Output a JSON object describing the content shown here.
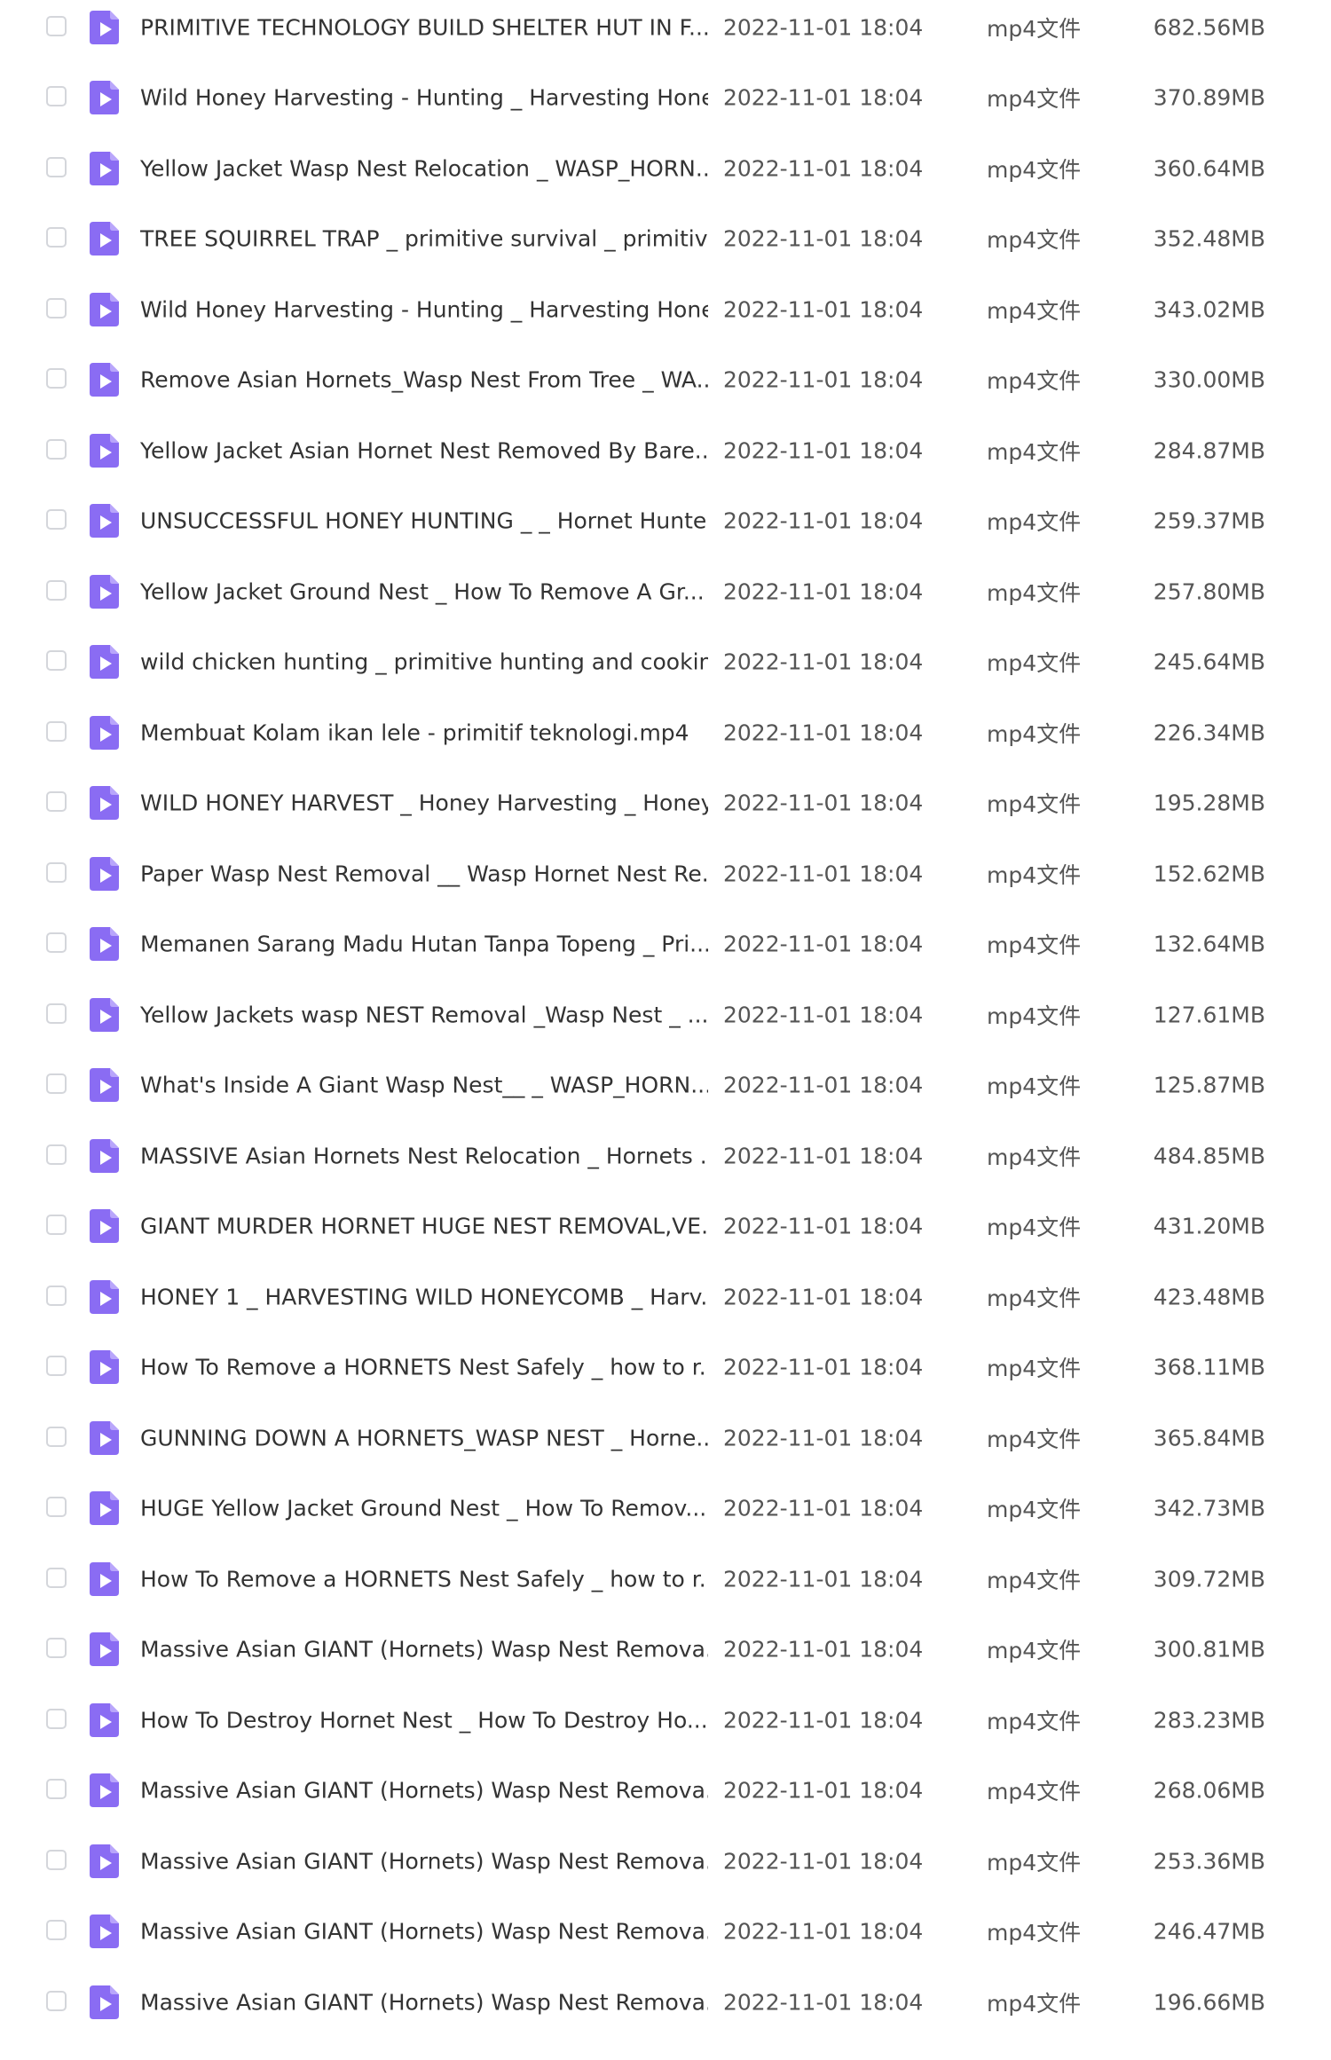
{
  "accent_color": "#8a6cf3",
  "file_icon": "video-file-icon",
  "files": [
    {
      "name": "PRIMITIVE TECHNOLOGY BUILD SHELTER HUT IN F...",
      "date": "2022-11-01 18:04",
      "type": "mp4文件",
      "size": "682.56MB"
    },
    {
      "name": "Wild Honey Harvesting - Hunting _ Harvesting Hone...",
      "date": "2022-11-01 18:04",
      "type": "mp4文件",
      "size": "370.89MB"
    },
    {
      "name": "Yellow Jacket Wasp Nest Relocation _ WASP_HORN...",
      "date": "2022-11-01 18:04",
      "type": "mp4文件",
      "size": "360.64MB"
    },
    {
      "name": "TREE SQUIRREL TRAP _ primitive survival _ primitiv...",
      "date": "2022-11-01 18:04",
      "type": "mp4文件",
      "size": "352.48MB"
    },
    {
      "name": "Wild Honey Harvesting - Hunting _ Harvesting Hone...",
      "date": "2022-11-01 18:04",
      "type": "mp4文件",
      "size": "343.02MB"
    },
    {
      "name": "Remove Asian Hornets_Wasp Nest From Tree _ WA...",
      "date": "2022-11-01 18:04",
      "type": "mp4文件",
      "size": "330.00MB"
    },
    {
      "name": "Yellow Jacket Asian Hornet Nest Removed By Bare...",
      "date": "2022-11-01 18:04",
      "type": "mp4文件",
      "size": "284.87MB"
    },
    {
      "name": "UNSUCCESSFUL HONEY HUNTING _ _ Hornet Hunte...",
      "date": "2022-11-01 18:04",
      "type": "mp4文件",
      "size": "259.37MB"
    },
    {
      "name": "Yellow Jacket Ground Nest _ How To Remove A Gr...",
      "date": "2022-11-01 18:04",
      "type": "mp4文件",
      "size": "257.80MB"
    },
    {
      "name": "wild chicken hunting _ primitive hunting and cookin...",
      "date": "2022-11-01 18:04",
      "type": "mp4文件",
      "size": "245.64MB"
    },
    {
      "name": "Membuat Kolam ikan lele - primitif teknologi.mp4",
      "date": "2022-11-01 18:04",
      "type": "mp4文件",
      "size": "226.34MB"
    },
    {
      "name": "WILD HONEY HARVEST _ Honey Harvesting _ Honey...",
      "date": "2022-11-01 18:04",
      "type": "mp4文件",
      "size": "195.28MB"
    },
    {
      "name": "Paper Wasp Nest Removal __ Wasp Hornet Nest Re...",
      "date": "2022-11-01 18:04",
      "type": "mp4文件",
      "size": "152.62MB"
    },
    {
      "name": "Memanen Sarang Madu Hutan Tanpa Topeng _ Pri...",
      "date": "2022-11-01 18:04",
      "type": "mp4文件",
      "size": "132.64MB"
    },
    {
      "name": "Yellow Jackets wasp NEST Removal _Wasp Nest _ ...",
      "date": "2022-11-01 18:04",
      "type": "mp4文件",
      "size": "127.61MB"
    },
    {
      "name": "What's Inside A Giant Wasp Nest__ _ WASP_HORN...",
      "date": "2022-11-01 18:04",
      "type": "mp4文件",
      "size": "125.87MB"
    },
    {
      "name": "MASSIVE Asian Hornets Nest Relocation _ Hornets ...",
      "date": "2022-11-01 18:04",
      "type": "mp4文件",
      "size": "484.85MB"
    },
    {
      "name": "GIANT MURDER HORNET HUGE NEST REMOVAL,VE...",
      "date": "2022-11-01 18:04",
      "type": "mp4文件",
      "size": "431.20MB"
    },
    {
      "name": "HONEY 1 _ HARVESTING WILD HONEYCOMB _ Harv...",
      "date": "2022-11-01 18:04",
      "type": "mp4文件",
      "size": "423.48MB"
    },
    {
      "name": "How To Remove a HORNETS Nest Safely _ how to r...",
      "date": "2022-11-01 18:04",
      "type": "mp4文件",
      "size": "368.11MB"
    },
    {
      "name": "GUNNING DOWN A HORNETS_WASP NEST _ Horne...",
      "date": "2022-11-01 18:04",
      "type": "mp4文件",
      "size": "365.84MB"
    },
    {
      "name": "HUGE Yellow Jacket Ground Nest _ How To Remov...",
      "date": "2022-11-01 18:04",
      "type": "mp4文件",
      "size": "342.73MB"
    },
    {
      "name": "How To Remove a HORNETS Nest Safely _ how to r...",
      "date": "2022-11-01 18:04",
      "type": "mp4文件",
      "size": "309.72MB"
    },
    {
      "name": "Massive Asian GIANT (Hornets) Wasp Nest Remova...",
      "date": "2022-11-01 18:04",
      "type": "mp4文件",
      "size": "300.81MB"
    },
    {
      "name": "How To Destroy Hornet Nest _ How To Destroy Ho...",
      "date": "2022-11-01 18:04",
      "type": "mp4文件",
      "size": "283.23MB"
    },
    {
      "name": "Massive Asian GIANT (Hornets) Wasp Nest Remova...",
      "date": "2022-11-01 18:04",
      "type": "mp4文件",
      "size": "268.06MB"
    },
    {
      "name": "Massive Asian GIANT (Hornets) Wasp Nest Remova...",
      "date": "2022-11-01 18:04",
      "type": "mp4文件",
      "size": "253.36MB"
    },
    {
      "name": "Massive Asian GIANT (Hornets) Wasp Nest Remova...",
      "date": "2022-11-01 18:04",
      "type": "mp4文件",
      "size": "246.47MB"
    },
    {
      "name": "Massive Asian GIANT (Hornets) Wasp Nest Remova...",
      "date": "2022-11-01 18:04",
      "type": "mp4文件",
      "size": "196.66MB"
    }
  ]
}
